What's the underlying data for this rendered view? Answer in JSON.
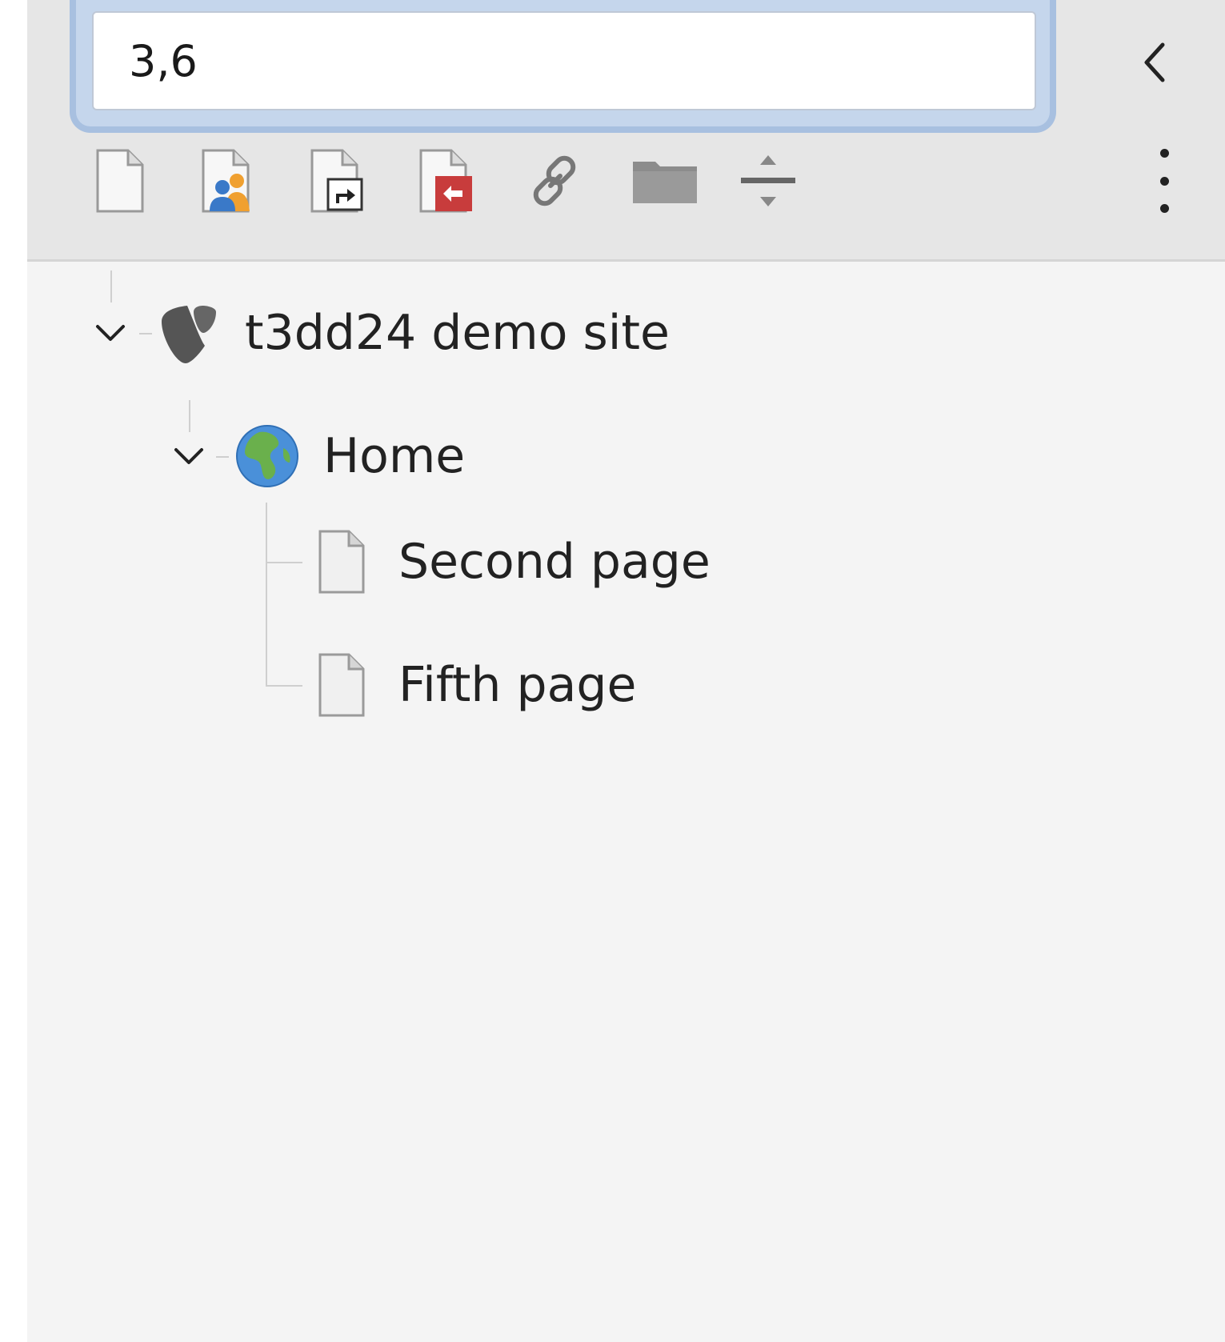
{
  "search": {
    "value": "3,6"
  },
  "toolbar": {
    "tools": [
      {
        "icon": "new-page-icon"
      },
      {
        "icon": "new-backend-user-section-icon"
      },
      {
        "icon": "new-shortcut-icon"
      },
      {
        "icon": "new-external-link-icon"
      },
      {
        "icon": "new-link-icon"
      },
      {
        "icon": "new-folder-icon"
      },
      {
        "icon": "new-spacer-icon"
      }
    ],
    "collapse_icon": "chevron-left-icon",
    "menu_icon": "vertical-ellipsis-icon"
  },
  "tree": {
    "root": {
      "label": "t3dd24 demo site",
      "icon": "typo3-logo-icon",
      "expanded": true
    },
    "home": {
      "label": "Home",
      "icon": "globe-icon",
      "expanded": true
    },
    "children": [
      {
        "label": "Second page",
        "icon": "page-icon"
      },
      {
        "label": "Fifth page",
        "icon": "page-icon"
      }
    ]
  },
  "colors": {
    "focus_ring": "#a8c0e0",
    "toolbar_bg": "#e6e6e6",
    "panel_bg": "#f4f4f4",
    "typo3_orange": "#ff8700",
    "shortcut_red": "#c83c3c"
  }
}
